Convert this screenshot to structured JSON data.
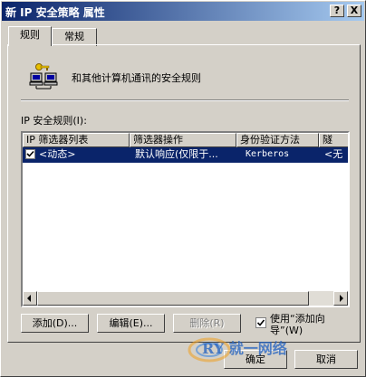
{
  "window": {
    "title": "新 IP 安全策略 属性"
  },
  "titlebar_buttons": {
    "help": "?",
    "close": "X"
  },
  "tabs": [
    {
      "label": "规则"
    },
    {
      "label": "常规"
    }
  ],
  "rules_panel": {
    "description": "和其他计算机通讯的安全规则",
    "list_label": "IP 安全规则(I):",
    "columns": [
      "IP 筛选器列表",
      "筛选器操作",
      "身份验证方法",
      "隧"
    ],
    "rows": [
      {
        "checked": true,
        "filter_list": "<动态>",
        "filter_action": "默认响应(仅限于...",
        "auth_method": "Kerberos",
        "tunnel": "<无"
      }
    ]
  },
  "buttons": {
    "add": "添加(D)...",
    "edit": "编辑(E)...",
    "remove": "删除(R)",
    "ok": "确定",
    "cancel": "取消"
  },
  "wizard_checkbox": {
    "checked": true,
    "label_line1": "使用“添加向",
    "label_line2": "导”(W)"
  },
  "watermark": {
    "text": "RY 就一网络"
  },
  "colors": {
    "title_active": "#0a246a",
    "selection": "#0a246a",
    "face": "#d4d0c8"
  }
}
